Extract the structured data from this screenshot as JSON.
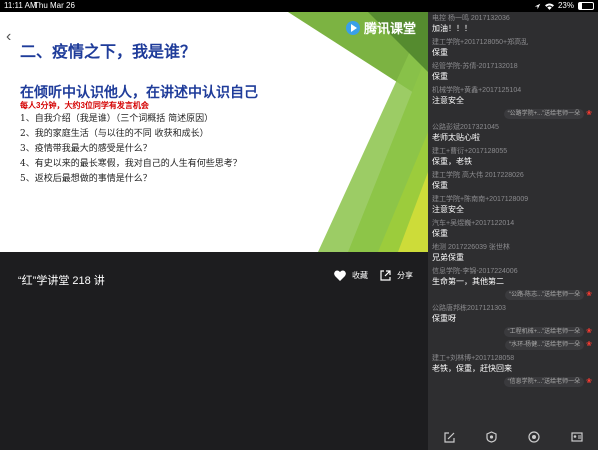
{
  "status": {
    "time": "11:11 AM",
    "date": "Thu Mar 26",
    "battery": "23%",
    "battery_level": 0.23
  },
  "video": {
    "logo_text": "腾讯课堂",
    "slide": {
      "title": "二、疫情之下，我是谁？",
      "subtitle": "在倾听中认识他人，在讲述中认识自己",
      "note": "每人3分钟，大约3位同学有发言机会",
      "items": [
        "1、自我介绍（我是谁）（三个词概括  简述原因）",
        "2、我的家庭生活（与以往的不同  收获和成长）",
        "3、疫情带我最大的感受是什么？",
        "4、有史以来的最长寒假，我对自己的人生有何些思考？",
        "5、返校后最想做的事情是什么？"
      ]
    }
  },
  "controls": {
    "course_title": "“红”学讲堂 218 讲",
    "favorite_label": "收藏",
    "share_label": "分享"
  },
  "chat": [
    {
      "type": "msg",
      "who": "电控 杨一鸣 2017132036",
      "text": "加油！！！"
    },
    {
      "type": "msg",
      "who": "建工学院+2017128050+郑高乱",
      "text": "保重"
    },
    {
      "type": "msg",
      "who": "经管学院-苏倩-2017132018",
      "text": "保重"
    },
    {
      "type": "msg",
      "who": "机械学院+黄鑫+2017125104",
      "text": "注意安全"
    },
    {
      "type": "gift",
      "text": "“公路学院+...”送给老师一朵"
    },
    {
      "type": "msg",
      "who": "公路彭斌2017321045",
      "text": "老师太贴心啦"
    },
    {
      "type": "msg",
      "who": "建工+曹衍+2017128055",
      "text": "保重，老铁"
    },
    {
      "type": "msg",
      "who": "建工学院 高大伟 2017228026",
      "text": "保重"
    },
    {
      "type": "msg",
      "who": "建工学院+陈南南+2017128009",
      "text": "注意安全"
    },
    {
      "type": "msg",
      "who": "汽车+吴煜巍+2017122014",
      "text": "保重"
    },
    {
      "type": "msg",
      "who": "地测 2017226039 张世林",
      "text": "兄弟保重"
    },
    {
      "type": "msg",
      "who": "信息学院-李锦-2017224006",
      "text": "生命第一，其他第二"
    },
    {
      "type": "gift",
      "text": "“公路-陈志...”送给老师一朵"
    },
    {
      "type": "msg",
      "who": "公路唐邦栋2017121303",
      "text": "保重呀"
    },
    {
      "type": "gift",
      "text": "“工程机械+...”送给老师一朵"
    },
    {
      "type": "gift",
      "text": "“水环-杨健...”送给老师一朵"
    },
    {
      "type": "msg",
      "who": "建工+刘林博+2017128058",
      "text": "老铁，保重，赶快回来"
    },
    {
      "type": "gift",
      "text": "“信息学院+...”送给老师一朵"
    }
  ]
}
